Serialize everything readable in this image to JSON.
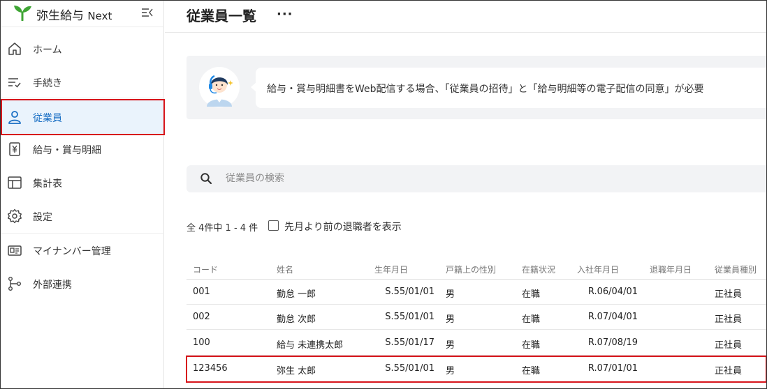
{
  "app": {
    "logo_text": "弥生給与",
    "logo_suffix": "Next",
    "brand_color": "#3fa535"
  },
  "sidebar": {
    "items": [
      {
        "label": "ホーム",
        "icon": "home-icon"
      },
      {
        "label": "手続き",
        "icon": "procedure-list-icon"
      },
      {
        "label": "従業員",
        "icon": "person-icon",
        "active": true
      },
      {
        "label": "給与・賞与明細",
        "icon": "yen-document-icon"
      },
      {
        "label": "集計表",
        "icon": "table-icon"
      },
      {
        "label": "設定",
        "icon": "gear-icon"
      },
      {
        "label": "マイナンバー管理",
        "icon": "id-card-icon"
      },
      {
        "label": "外部連携",
        "icon": "integration-icon"
      }
    ]
  },
  "header": {
    "title": "従業員一覧",
    "more": "···"
  },
  "notice": {
    "text": "給与・賞与明細書をWeb配信する場合、「従業員の招待」と「給与明細等の電子配信の同意」が必要"
  },
  "search": {
    "placeholder": "従業員の検索",
    "value": ""
  },
  "list": {
    "count_text": "全 4件中 1 - 4 件",
    "retired_checkbox_label": "先月より前の退職者を表示",
    "retired_checked": false,
    "columns": [
      "コード",
      "姓名",
      "生年月日",
      "戸籍上の性別",
      "在籍状況",
      "入社年月日",
      "退職年月日",
      "従業員種別"
    ],
    "rows": [
      {
        "code": "001",
        "name": "勤怠 一郎",
        "birth": "S.55/01/01",
        "sex": "男",
        "status": "在職",
        "joined": "R.06/04/01",
        "retired": "",
        "type": "正社員"
      },
      {
        "code": "002",
        "name": "勤怠 次郎",
        "birth": "S.55/01/01",
        "sex": "男",
        "status": "在職",
        "joined": "R.07/04/01",
        "retired": "",
        "type": "正社員"
      },
      {
        "code": "100",
        "name": "給与 未連携太郎",
        "birth": "S.55/01/17",
        "sex": "男",
        "status": "在職",
        "joined": "R.07/08/19",
        "retired": "",
        "type": "正社員"
      },
      {
        "code": "123456",
        "name": "弥生 太郎",
        "birth": "S.55/01/01",
        "sex": "男",
        "status": "在職",
        "joined": "R.07/01/01",
        "retired": "",
        "type": "正社員"
      }
    ]
  },
  "colors": {
    "accent": "#1a6fc4",
    "highlight": "#d7141a",
    "active_bg": "#eaf3fc"
  }
}
